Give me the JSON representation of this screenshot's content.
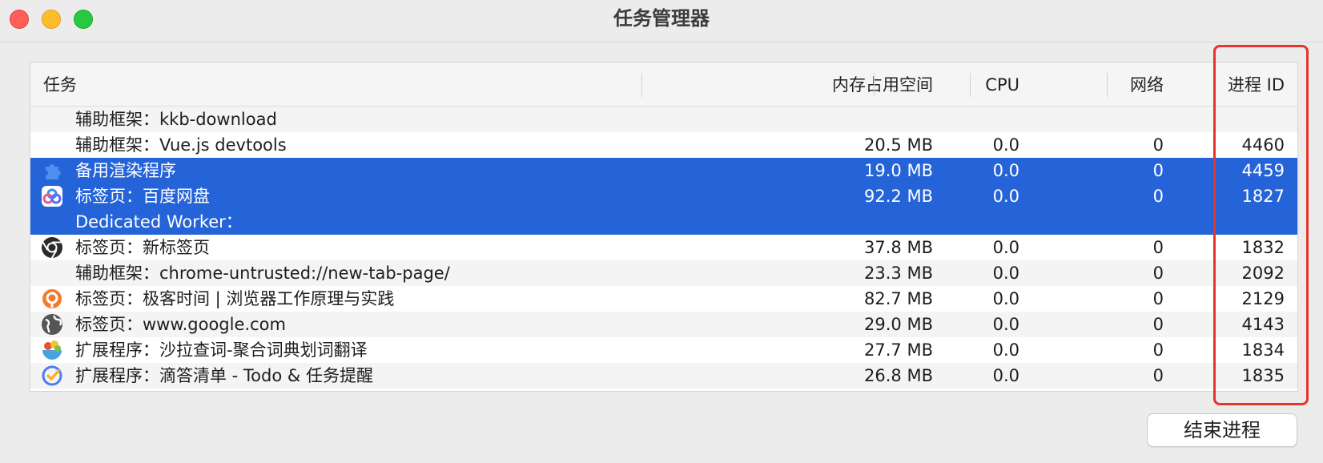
{
  "window": {
    "title": "任务管理器"
  },
  "columns": {
    "task": "任务",
    "memory": "内存占用空间",
    "cpu": "CPU",
    "network": "网络",
    "pid": "进程 ID"
  },
  "rows": [
    {
      "name": "辅助框架：kkb-download",
      "memory": "",
      "cpu": "",
      "network": "",
      "pid": "",
      "icon": "none",
      "selected": false
    },
    {
      "name": "辅助框架：Vue.js devtools",
      "memory": "20.5 MB",
      "cpu": "0.0",
      "network": "0",
      "pid": "4460",
      "icon": "none",
      "selected": false
    },
    {
      "name": "备用渲染程序",
      "memory": "19.0 MB",
      "cpu": "0.0",
      "network": "0",
      "pid": "4459",
      "icon": "puzzle-icon",
      "selected": true
    },
    {
      "name": "标签页：百度网盘",
      "memory": "92.2 MB",
      "cpu": "0.0",
      "network": "0",
      "pid": "1827",
      "icon": "baidu-netdisk-icon",
      "selected": true
    },
    {
      "name": "Dedicated Worker：",
      "memory": "",
      "cpu": "",
      "network": "",
      "pid": "",
      "icon": "none",
      "selected": true
    },
    {
      "name": "标签页：新标签页",
      "memory": "37.8 MB",
      "cpu": "0.0",
      "network": "0",
      "pid": "1832",
      "icon": "chrome-icon",
      "selected": false
    },
    {
      "name": "辅助框架：chrome-untrusted://new-tab-page/",
      "memory": "23.3 MB",
      "cpu": "0.0",
      "network": "0",
      "pid": "2092",
      "icon": "none",
      "selected": false
    },
    {
      "name": "标签页：极客时间 | 浏览器工作原理与实践",
      "memory": "82.7 MB",
      "cpu": "0.0",
      "network": "0",
      "pid": "2129",
      "icon": "geektime-icon",
      "selected": false
    },
    {
      "name": "标签页：www.google.com",
      "memory": "29.0 MB",
      "cpu": "0.0",
      "network": "0",
      "pid": "4143",
      "icon": "globe-icon",
      "selected": false
    },
    {
      "name": "扩展程序：沙拉查词-聚合词典划词翻译",
      "memory": "27.7 MB",
      "cpu": "0.0",
      "network": "0",
      "pid": "1834",
      "icon": "salad-dict-icon",
      "selected": false
    },
    {
      "name": "扩展程序：滴答清单 - Todo & 任务提醒",
      "memory": "26.8 MB",
      "cpu": "0.0",
      "network": "0",
      "pid": "1835",
      "icon": "ticktick-icon",
      "selected": false
    }
  ],
  "footer": {
    "end_process_label": "结束进程"
  },
  "colors": {
    "selection": "#2563d8",
    "highlight_border": "#e5362b"
  }
}
